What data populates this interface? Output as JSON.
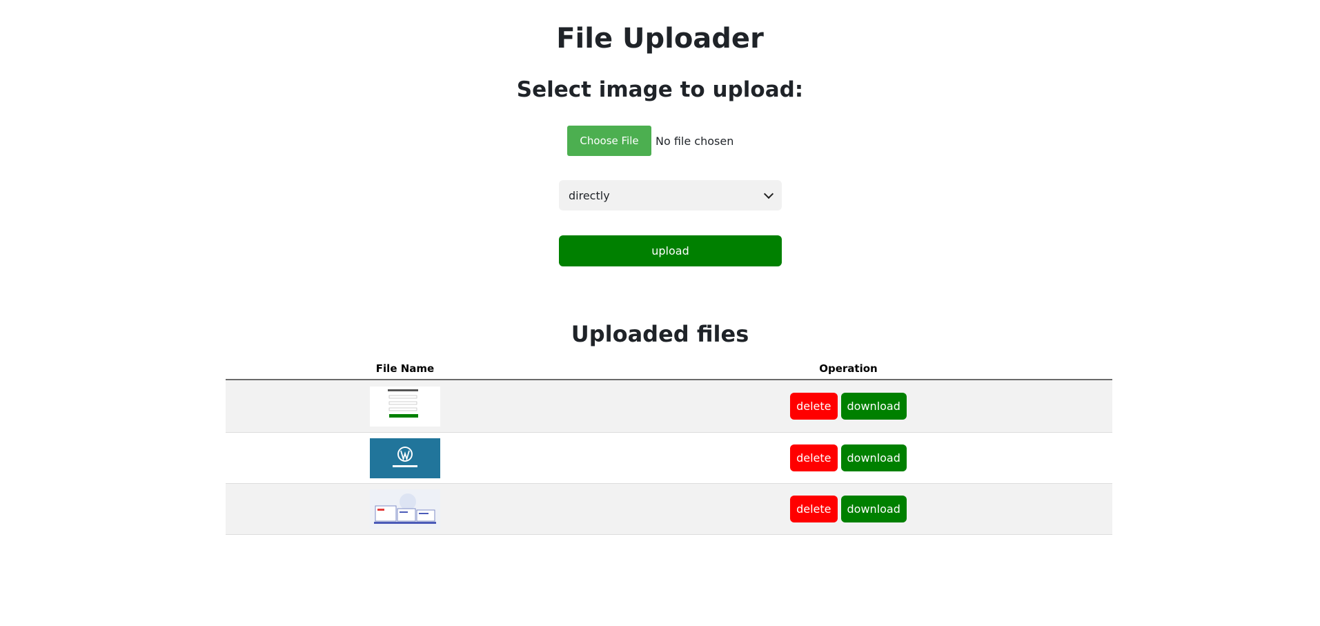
{
  "header": {
    "title": "File Uploader",
    "subtitle": "Select image to upload:"
  },
  "form": {
    "choose_file_label": "Choose File",
    "no_file_text": "No file chosen",
    "select_value": "directly",
    "upload_label": "upload"
  },
  "uploaded": {
    "heading": "Uploaded files",
    "columns": [
      "File Name",
      "Operation"
    ],
    "rows": [
      {
        "thumbnail": "login-form-screenshot-thumbnail",
        "delete_label": "delete",
        "download_label": "download"
      },
      {
        "thumbnail": "wordpress-logo-thumbnail",
        "delete_label": "delete",
        "download_label": "download"
      },
      {
        "thumbnail": "dashboard-illustration-thumbnail",
        "delete_label": "delete",
        "download_label": "download"
      }
    ]
  },
  "colors": {
    "choose_button": "#4caf50",
    "upload_button": "#008000",
    "delete_button": "#ff0000",
    "download_button": "#008000",
    "wordpress_blue": "#21759b"
  }
}
